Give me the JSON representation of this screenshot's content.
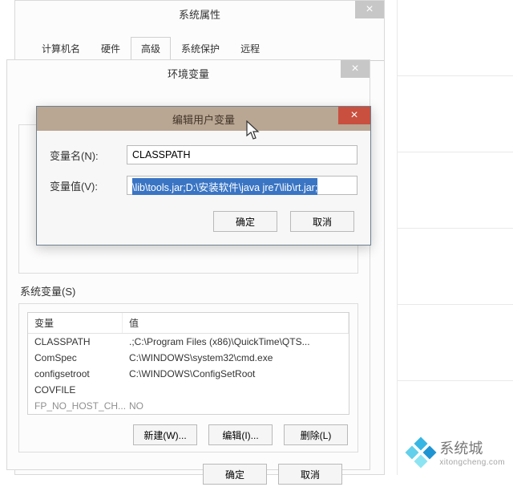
{
  "sysProps": {
    "title": "系统属性",
    "tabs": [
      "计算机名",
      "硬件",
      "高级",
      "系统保护",
      "远程"
    ],
    "activeTab": 2
  },
  "envVars": {
    "title": "环境变量",
    "systemSectionLabel": "系统变量(S)",
    "columns": {
      "name": "变量",
      "value": "值"
    },
    "rows": [
      {
        "name": "CLASSPATH",
        "value": ".;C:\\Program Files (x86)\\QuickTime\\QTS..."
      },
      {
        "name": "ComSpec",
        "value": "C:\\WINDOWS\\system32\\cmd.exe"
      },
      {
        "name": "configsetroot",
        "value": "C:\\WINDOWS\\ConfigSetRoot"
      },
      {
        "name": "COVFILE",
        "value": ""
      },
      {
        "name": "FP_NO_HOST_CH...",
        "value": "NO"
      }
    ],
    "buttons": {
      "new": "新建(W)...",
      "edit": "编辑(I)...",
      "delete": "删除(L)"
    },
    "footer": {
      "ok": "确定",
      "cancel": "取消"
    }
  },
  "editDialog": {
    "title": "编辑用户变量",
    "nameLabel": "变量名(N):",
    "valueLabel": "变量值(V):",
    "nameValue": "CLASSPATH",
    "valueValue": "\\lib\\tools.jar;D:\\安装软件\\java jre7\\lib\\rt.jar;",
    "ok": "确定",
    "cancel": "取消"
  },
  "branding": {
    "name": "系统城",
    "url": "xitongcheng.com"
  }
}
